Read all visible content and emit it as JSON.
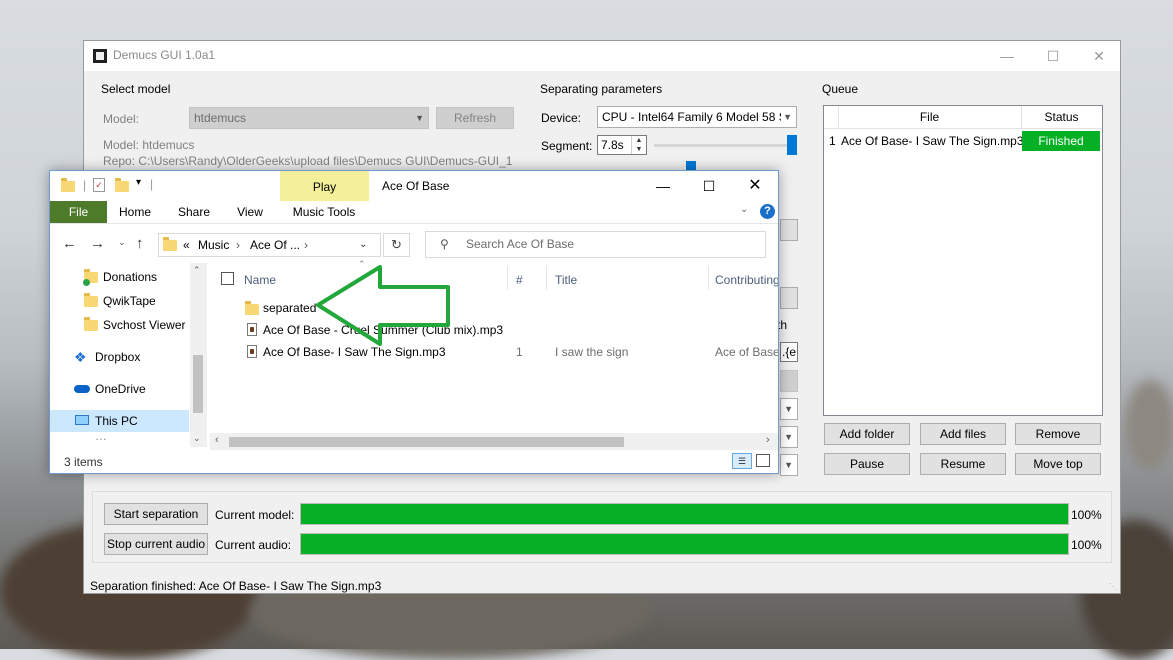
{
  "demucs": {
    "title": "Demucs GUI 1.0a1",
    "select_model": {
      "group_title": "Select model",
      "model_label": "Model:",
      "model_value": "htdemucs",
      "refresh": "Refresh",
      "model_info": "Model: htdemucs",
      "repo_info": "Repo: C:\\Users\\Randy\\OlderGeeks\\upload files\\Demucs GUI\\Demucs-GUI_1"
    },
    "params": {
      "group_title": "Separating parameters",
      "device_label": "Device:",
      "device_value": "CPU - Intel64 Family 6 Model 58 S",
      "segment_label": "Segment:",
      "segment_value": "7.8s",
      "output_partial": "th",
      "output_partial2": ".{e"
    },
    "queue": {
      "group_title": "Queue",
      "col_file": "File",
      "col_status": "Status",
      "rows": [
        {
          "index": "1",
          "file": "Ace Of Base- I Saw The Sign.mp3",
          "status": "Finished"
        }
      ],
      "add_folder": "Add folder",
      "add_files": "Add files",
      "remove": "Remove",
      "pause": "Pause",
      "resume": "Resume",
      "move_top": "Move top"
    },
    "bottom": {
      "start": "Start separation",
      "stop": "Stop current audio",
      "current_model_label": "Current model:",
      "current_audio_label": "Current audio:",
      "model_progress": "100%",
      "audio_progress": "100%",
      "status_bar": "Separation finished: Ace Of Base- I Saw The Sign.mp3"
    },
    "colors": {
      "progress": "#06b025",
      "finished": "#06b025"
    }
  },
  "explorer": {
    "title": "Ace Of Base",
    "play_tab": "Play",
    "tabs": [
      "File",
      "Home",
      "Share",
      "View",
      "Music Tools"
    ],
    "breadcrumb": {
      "prefix": "«",
      "parts": [
        "Music",
        "Ace Of ..."
      ]
    },
    "search_placeholder": "Search Ace Of Base",
    "nav": [
      "Donations",
      "QwikTape",
      "Svchost Viewer",
      "Dropbox",
      "OneDrive",
      "This PC"
    ],
    "columns": {
      "name": "Name",
      "number": "#",
      "title": "Title",
      "contributing": "Contributing"
    },
    "rows": [
      {
        "name": "separated",
        "number": "",
        "title": "",
        "contributing": "",
        "type": "folder"
      },
      {
        "name": "Ace Of Base - Cruel Summer (Club mix).mp3",
        "number": "",
        "title": "",
        "contributing": "",
        "type": "mp3"
      },
      {
        "name": "Ace Of Base- I Saw The Sign.mp3",
        "number": "1",
        "title": "I saw the sign",
        "contributing": "Ace of Base",
        "type": "mp3"
      }
    ],
    "item_count": "3 items",
    "colors": {
      "ribbon_file": "#4e7b2a",
      "play_tab": "#f4f09a"
    }
  },
  "annotation": {
    "arrow_color": "#22a83a"
  }
}
